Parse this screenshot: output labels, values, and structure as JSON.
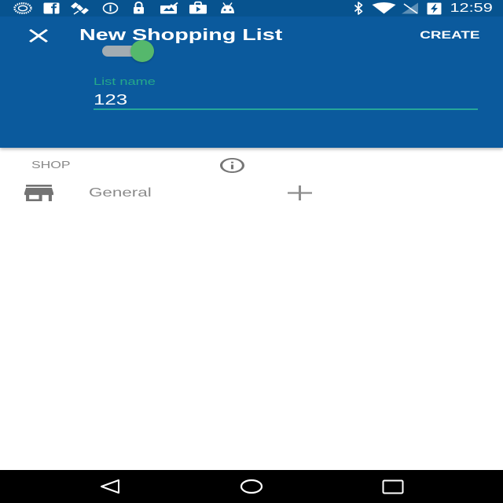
{
  "status_bar": {
    "time": "12:59",
    "notification_icons": [
      "dial-icon",
      "facebook-icon",
      "satellite-icon",
      "alert-circle-icon",
      "lock-icon",
      "photo-icon",
      "play-store-icon",
      "android-icon"
    ],
    "system_icons": [
      "bluetooth-icon",
      "wifi-icon",
      "signal-off-icon",
      "battery-charging-icon"
    ]
  },
  "toolbar": {
    "close_icon": "close-icon",
    "title": "New Shopping List",
    "action_label": "CREATE",
    "toggle_on": true
  },
  "list_name_field": {
    "label": "List name",
    "value": "123"
  },
  "shop_section": {
    "header": "SHOP",
    "header_icon": "info-icon",
    "items": [
      {
        "label": "General",
        "icon": "store-icon",
        "action_icon": "add-icon"
      }
    ]
  },
  "nav_bar": {
    "buttons": [
      "back-icon",
      "home-icon",
      "recents-icon"
    ]
  },
  "colors": {
    "primary": "#0b5a9d",
    "status_bar": "#07538f",
    "accent": "#26a69a",
    "label_accent": "#25a98a",
    "toggle_thumb": "#55b86c",
    "toggle_track": "#a3acb2",
    "secondary_text": "#8a8a8a",
    "icon_grey": "#737373",
    "nav_bar": "#000000"
  }
}
